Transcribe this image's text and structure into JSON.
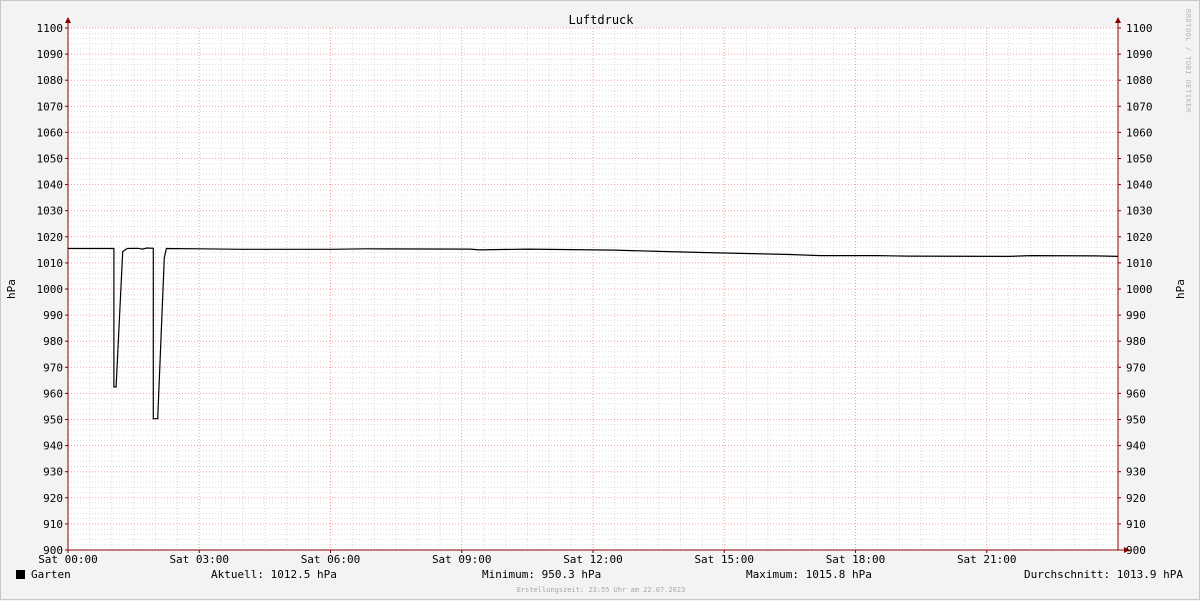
{
  "chart_data": {
    "type": "line",
    "title": "Luftdruck",
    "ylabel": "hPa",
    "ylabel_right": "hPa",
    "ylim": [
      900,
      1100
    ],
    "y_ticks": [
      900,
      910,
      920,
      930,
      940,
      950,
      960,
      970,
      980,
      990,
      1000,
      1010,
      1020,
      1030,
      1040,
      1050,
      1060,
      1070,
      1080,
      1090,
      1100
    ],
    "x_range_hours": [
      0,
      24
    ],
    "x_ticks": [
      {
        "hour": 0,
        "label": "Sat 00:00"
      },
      {
        "hour": 3,
        "label": "Sat 03:00"
      },
      {
        "hour": 6,
        "label": "Sat 06:00"
      },
      {
        "hour": 9,
        "label": "Sat 09:00"
      },
      {
        "hour": 12,
        "label": "Sat 12:00"
      },
      {
        "hour": 15,
        "label": "Sat 15:00"
      },
      {
        "hour": 18,
        "label": "Sat 18:00"
      },
      {
        "hour": 21,
        "label": "Sat 21:00"
      }
    ],
    "grid": true,
    "series": [
      {
        "name": "Garten",
        "color": "#000000",
        "points": [
          [
            0,
            1015.5
          ],
          [
            1.05,
            1015.5
          ],
          [
            1.05,
            962.5
          ],
          [
            1.1,
            962.5
          ],
          [
            1.25,
            1014.3
          ],
          [
            1.35,
            1015.5
          ],
          [
            1.6,
            1015.6
          ],
          [
            1.7,
            1015.3
          ],
          [
            1.8,
            1015.7
          ],
          [
            1.95,
            1015.6
          ],
          [
            1.95,
            950.3
          ],
          [
            2.05,
            950.3
          ],
          [
            2.2,
            1012.0
          ],
          [
            2.25,
            1015.5
          ],
          [
            3.0,
            1015.4
          ],
          [
            4.0,
            1015.2
          ],
          [
            6.0,
            1015.2
          ],
          [
            6.8,
            1015.4
          ],
          [
            9.2,
            1015.3
          ],
          [
            9.4,
            1015.0
          ],
          [
            10.5,
            1015.3
          ],
          [
            11.5,
            1015.1
          ],
          [
            12.5,
            1014.9
          ],
          [
            13.5,
            1014.4
          ],
          [
            14.5,
            1014.0
          ],
          [
            15.5,
            1013.6
          ],
          [
            16.5,
            1013.2
          ],
          [
            17.2,
            1012.8
          ],
          [
            18.5,
            1012.8
          ],
          [
            19.2,
            1012.6
          ],
          [
            21.5,
            1012.5
          ],
          [
            22.0,
            1012.8
          ],
          [
            23.5,
            1012.7
          ],
          [
            24.0,
            1012.5
          ]
        ]
      }
    ]
  },
  "legend": {
    "series_name": "Garten",
    "current": "Aktuell: 1012.5 hPa",
    "minimum": "Minimum: 950.3 hPa",
    "maximum": "Maximum: 1015.8 hPa",
    "average": "Durchschnitt: 1013.9 hPA"
  },
  "footer": "Erstellungszeit: 23:55 Uhr am 22.07.2023",
  "watermark": "RRDTOOL / TOBI OETIKER",
  "colors": {
    "grid_minor": "#dcdcdc",
    "grid_major": "#f0a0a0",
    "axis": "#8b0000",
    "line": "#000000"
  }
}
